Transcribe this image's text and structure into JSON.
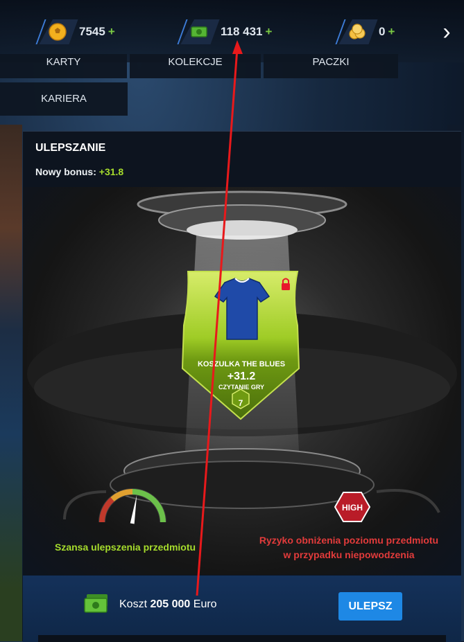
{
  "currencies": [
    {
      "icon": "gold-ball-icon",
      "value": "7545",
      "plus": "+"
    },
    {
      "icon": "cash-icon",
      "value": "118 431",
      "plus": "+"
    },
    {
      "icon": "coins-icon",
      "value": "0",
      "plus": "+"
    }
  ],
  "nav": {
    "tab_cards": "KARTY",
    "tab_collections": "KOLEKCJE",
    "tab_packs": "PACZKI",
    "tab_career": "KARIERA"
  },
  "upgrade": {
    "title": "ULEPSZANIE",
    "bonus_label": "Nowy bonus:",
    "bonus_value": "+31.8"
  },
  "card": {
    "name": "KOSZULKA THE BLUES",
    "value": "+31.2",
    "attribute": "CZYTANIE GRY",
    "level": "7",
    "locked": true
  },
  "chance": {
    "label": "Szansa ulepszenia przedmiotu",
    "level": 0.55
  },
  "risk": {
    "badge": "HIGH",
    "label_line1": "Ryzyko obniżenia poziomu przedmiotu",
    "label_line2": "w przypadku niepowodzenia"
  },
  "cost": {
    "prefix": "Koszt",
    "amount": "205 000",
    "currency": "Euro",
    "button": "ULEPSZ"
  },
  "colors": {
    "accent_green": "#a6dc2c",
    "risk_red": "#e23b3b",
    "button_blue": "#1e88e5",
    "annotation_red": "#e8191b"
  }
}
